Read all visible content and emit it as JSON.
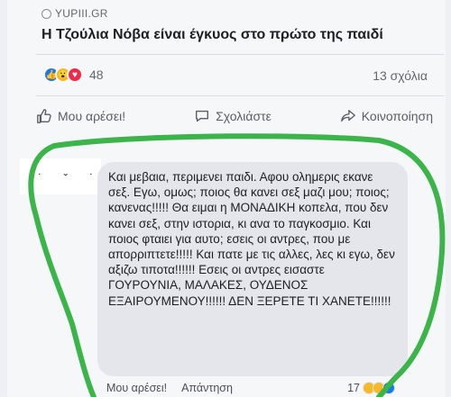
{
  "post": {
    "source": "YUPIII.GR",
    "headline": "Η Τζούλια Νόβα είναι έγκυος στο πρώτο της παιδί",
    "reaction_count": "48",
    "comments_count": "13 σχόλια"
  },
  "actions": {
    "like": "Μου αρέσει!",
    "comment": "Σχολιάστε",
    "share": "Κοινοποίηση"
  },
  "comment": {
    "avatar_marks": "˙ ˇ ˙",
    "text": "Και μεβαια, περιμενει παιδι. Αφου ολημερις εκανε σεξ. Εγω, ομως; ποιος θα κανει σεξ μαζι μου; ποιος; κανενας!!!!! Θα ειμαι η ΜΟΝΑΔΙΚΗ κοπελα, που δεν κανει σεξ, στην ιστορια, κι ανα το παγκοσμιο. Και ποιος φταιει για αυτο; εσεις οι αντρες, που με απορριπτετε!!!!! Και πατε με τις αλλες, λες κι εγω, δεν αξιζω τιποτα!!!!!! Εσεις οι αντρες εισαστε ΓΟΥΡΟΥΝΙΑ, ΜΑΛΑΚΕΣ, ΟΥΔΕΝΟΣ ΕΞΑΙΡΟΥΜΕΝΟΥ!!!!!! ΔΕΝ ΞΕΡΕΤΕ ΤΙ ΧΑΝΕΤΕ!!!!!!",
    "like_label": "Μου αρέσει!",
    "reply_label": "Απάντηση",
    "reaction_count": "17"
  },
  "colors": {
    "like_blue": "#1877f2",
    "love_red": "#f02849",
    "wow_yellow": "#f7b928",
    "highlight_green": "#3bb54a"
  }
}
